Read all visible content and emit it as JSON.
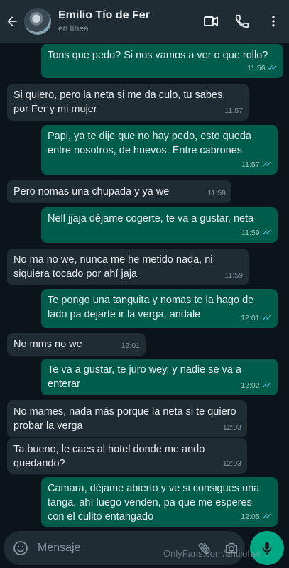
{
  "header": {
    "contact_name": "Emilio Tío de Fer",
    "status": "en línea"
  },
  "messages": [
    {
      "dir": "out",
      "text": "Tons que pedo? Si nos vamos a ver o que rollo?",
      "time": "11:56",
      "read": true
    },
    {
      "dir": "in",
      "text": "Si quiero, pero la neta si me da culo, tu sabes, por Fer y mi mujer",
      "time": "11:57"
    },
    {
      "dir": "out",
      "text": "Papi, ya te dije que no hay pedo, esto queda entre nosotros, de huevos. Entre cabrones",
      "time": "11:57",
      "read": true
    },
    {
      "dir": "in",
      "text": "Pero nomas una chupada y ya we",
      "time": "11:59"
    },
    {
      "dir": "out",
      "text": "Nell jjaja déjame cogerte, te va a gustar, neta",
      "time": "11:59",
      "read": true
    },
    {
      "dir": "in",
      "text": "No ma no we, nunca me he metido nada, ni siquiera tocado por ahí jaja",
      "time": "11:59"
    },
    {
      "dir": "out",
      "text": "Te pongo una tanguita y nomas te la hago de lado pa dejarte ir la verga, andale",
      "time": "12:01",
      "read": true
    },
    {
      "dir": "in",
      "text": "No mms no we",
      "time": "12:01"
    },
    {
      "dir": "out",
      "text": "Te va a gustar, te juro wey, y nadie se va a enterar",
      "time": "12:02",
      "read": true
    },
    {
      "dir": "in",
      "text": "No mames, nada más porque la neta si te quiero probar la verga",
      "time": "12:03"
    },
    {
      "dir": "in",
      "text": "Ta bueno, le caes al hotel donde me ando quedando?",
      "time": "12:03"
    },
    {
      "dir": "out",
      "text": "Cámara, déjame abierto y ve si consigues una tanga, ahí luego venden, pa que me esperes con el culito entangado",
      "time": "12:05",
      "read": true
    }
  ],
  "composer": {
    "placeholder": "Mensaje"
  },
  "watermark": "OnlyFans.com/antiloher",
  "colors": {
    "header_bg": "#1f2c34",
    "chat_bg": "#0b141a",
    "outgoing_bubble": "#005c4b",
    "incoming_bubble": "#1f2c34",
    "read_ticks": "#53bdeb",
    "mic_button": "#00a884"
  },
  "icons": {
    "back": "arrow-left-icon",
    "video": "video-camera-icon",
    "call": "phone-icon",
    "menu": "more-vertical-icon",
    "emoji": "emoji-icon",
    "attach": "paperclip-icon",
    "camera": "camera-icon",
    "mic": "microphone-icon"
  }
}
